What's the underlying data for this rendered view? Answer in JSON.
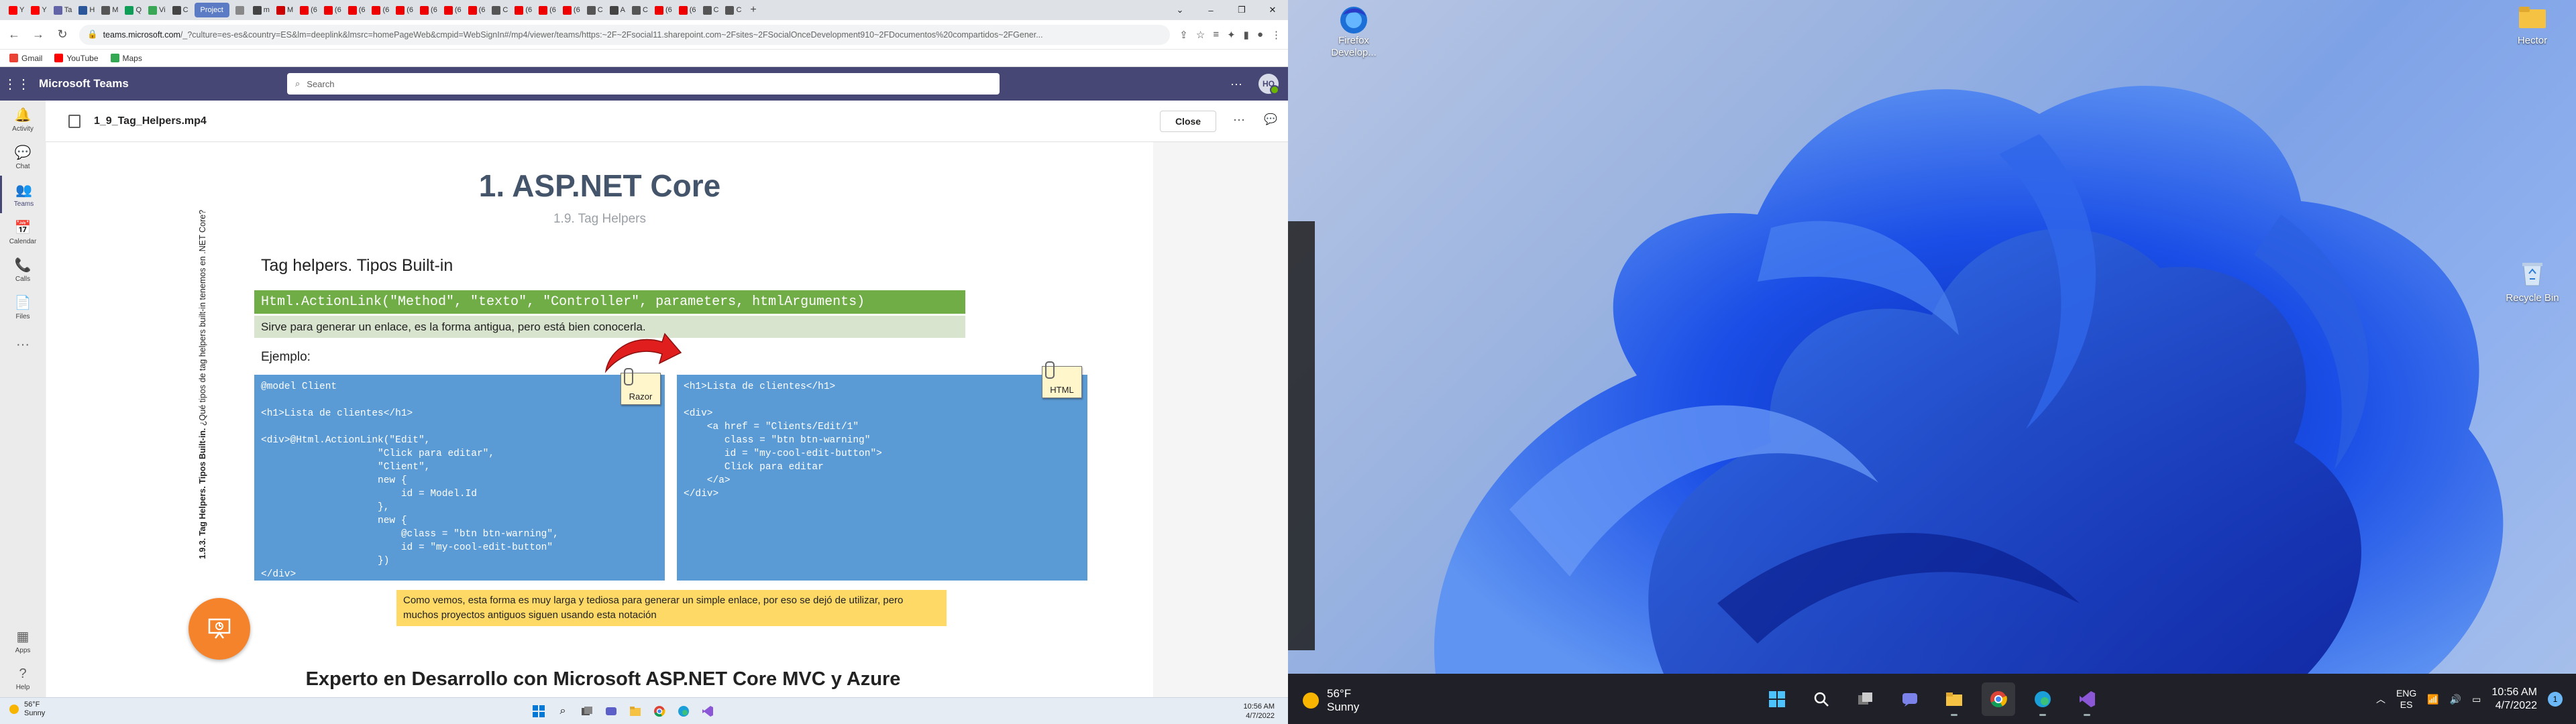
{
  "browser": {
    "tab_labels": [
      "Y",
      "Y",
      "Ta",
      "H",
      "M",
      "Q",
      "Vi",
      "C",
      "",
      "m",
      "M",
      "(6",
      "(6",
      "(6",
      "(6",
      "(6",
      "(6",
      "(6",
      "(6",
      "C",
      "(6",
      "(6",
      "(6",
      "C",
      "A",
      "C",
      "(6",
      "(6",
      "C",
      "C"
    ],
    "active_tab": "Project",
    "address_host": "teams.microsoft.com",
    "address_path": "/_?culture=es-es&country=ES&lm=deeplink&lmsrc=homePageWeb&cmpid=WebSignIn#/mp4/viewer/teams/https:~2F~2Fsocial11.sharepoint.com~2Fsites~2FSocialOnceDevelopment910~2FDocumentos%20compartidos~2FGener...",
    "bookmarks": [
      {
        "label": "Gmail",
        "color": "#ea4335"
      },
      {
        "label": "YouTube",
        "color": "#ff0000"
      },
      {
        "label": "Maps",
        "color": "#34a853"
      }
    ]
  },
  "teams": {
    "app_title": "Microsoft Teams",
    "search_placeholder": "Search",
    "avatar_initials": "HO",
    "rail": [
      {
        "label": "Activity",
        "icon": "bell-icon"
      },
      {
        "label": "Chat",
        "icon": "chat-icon"
      },
      {
        "label": "Teams",
        "icon": "teams-icon"
      },
      {
        "label": "Calendar",
        "icon": "calendar-icon"
      },
      {
        "label": "Calls",
        "icon": "phone-icon"
      },
      {
        "label": "Files",
        "icon": "file-icon"
      }
    ],
    "rail_bottom": [
      {
        "label": "Apps",
        "icon": "apps-icon"
      },
      {
        "label": "Help",
        "icon": "help-icon"
      }
    ],
    "file_name": "1_9_Tag_Helpers.mp4",
    "close_label": "Close"
  },
  "slide": {
    "title": "1. ASP.NET Core",
    "subtitle": "1.9. Tag Helpers",
    "vertical_bold": "1.9.3. Tag Helpers. Tipos Built-in.",
    "vertical_text": " ¿Qué tipos de tag helpers built-in tenemos en .NET Core?",
    "heading": "Tag helpers. Tipos Built-in",
    "code_signature": "Html.ActionLink(\"Method\", \"texto\", \"Controller\", parameters, htmlArguments)",
    "description": "Sirve para generar un enlace, es la forma antigua, pero está bien conocerla.",
    "example_label": "Ejemplo:",
    "razor_code": "@model Client\n\n<h1>Lista de clientes</h1>\n\n<div>@Html.ActionLink(\"Edit\",\n                    \"Click para editar\",\n                    \"Client\",\n                    new {\n                        id = Model.Id\n                    },\n                    new {\n                        @class = \"btn btn-warning\",\n                        id = \"my-cool-edit-button\"\n                    })\n</div>",
    "razor_tag": "Razor",
    "html_code": "<h1>Lista de clientes</h1>\n\n<div>\n    <a href = \"Clients/Edit/1\"\n       class = \"btn btn-warning\"\n       id = \"my-cool-edit-button\">\n       Click para editar\n    </a>\n</div>",
    "html_tag": "HTML",
    "note": "Como vemos, esta forma es muy larga y tediosa para generar un simple enlace, por eso se dejó de utilizar, pero muchos proyectos antiguos siguen usando esta notación",
    "footer": "Experto en Desarrollo con Microsoft ASP.NET Core MVC y Azure"
  },
  "taskbar_left": {
    "temp": "56°F",
    "condition": "Sunny",
    "time": "10:56 AM",
    "date": "4/7/2022"
  },
  "desktop": {
    "icons": [
      {
        "label": "Firefox Develop...",
        "icon": "firefox-developer-icon"
      },
      {
        "label": "Hector",
        "icon": "folder-icon"
      },
      {
        "label": "Recycle Bin",
        "icon": "recycle-bin-icon"
      }
    ]
  },
  "taskbar_right": {
    "temp": "56°F",
    "condition": "Sunny",
    "lang_top": "ENG",
    "lang_bottom": "ES",
    "time": "10:56 AM",
    "date": "4/7/2022",
    "notifications": "1"
  },
  "colors": {
    "teams_purple": "#464775",
    "slide_green": "#70ad47",
    "slide_blue": "#5b9bd5",
    "note_yellow": "#ffd966",
    "present_orange": "#f5832b"
  }
}
